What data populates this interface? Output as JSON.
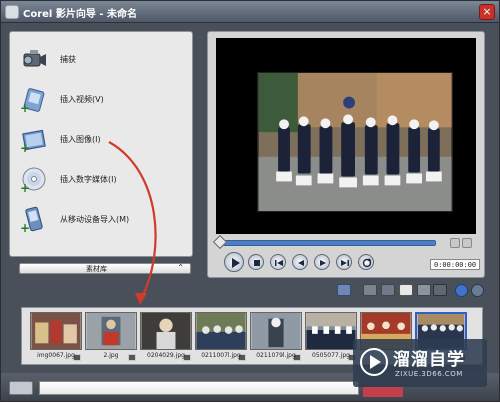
{
  "window": {
    "title": "Corel 影片向导 - 未命名",
    "close_label": "×"
  },
  "capture": {
    "items": [
      {
        "label": "捕获",
        "icon": "camcorder-icon"
      },
      {
        "label": "插入视频(V)",
        "icon": "insert-video-icon"
      },
      {
        "label": "插入图像(I)",
        "icon": "insert-image-icon"
      },
      {
        "label": "插入数字媒体(I)",
        "icon": "disc-icon"
      },
      {
        "label": "从移动设备导入(M)",
        "icon": "mobile-device-icon"
      }
    ]
  },
  "library": {
    "label": "素材库",
    "toggle": "⌃"
  },
  "player": {
    "timecode": "0:00:00:00",
    "progress": 0.0
  },
  "storyboard": {
    "clips": [
      {
        "label": "img0067.jpg",
        "bg": "#7a5248"
      },
      {
        "label": "2.jpg",
        "bg": "#9aa2a8"
      },
      {
        "label": "0204029.jpg",
        "bg": "#3e3d3a"
      },
      {
        "label": "0211007l.jpg",
        "bg": "#6f7a56"
      },
      {
        "label": "0211079l.jpg",
        "bg": "#8f9aa4"
      },
      {
        "label": "0505077.jpg",
        "bg": "#7e8c9c"
      },
      {
        "label": "",
        "bg": "#a33a2a"
      },
      {
        "label": "",
        "bg": "#2c3550"
      }
    ]
  },
  "watermark": {
    "title": "溜溜自学",
    "subtitle": "ZIXUE.3D66.COM"
  },
  "colors": {
    "accent_blue": "#4d7fc4",
    "arrow_red": "#d23a2b",
    "selected_border": "#2e5fd1"
  }
}
